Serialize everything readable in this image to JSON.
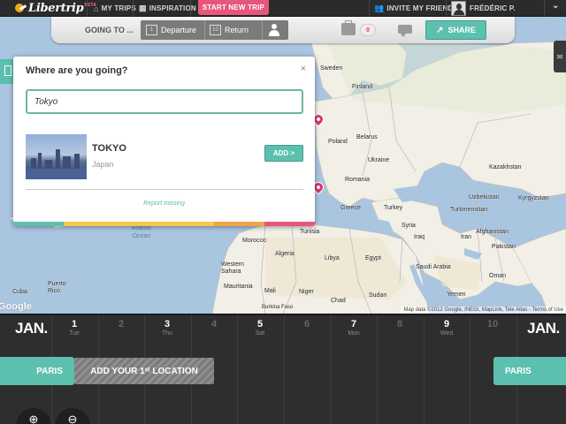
{
  "nav": {
    "logo_text": "Libertrip",
    "beta": "BETA",
    "my_trips": "MY TRIPS",
    "inspiration": "INSPIRATION",
    "start_new_trip": "START NEW TRIP",
    "invite_friends": "INVITE MY FRIENDS",
    "user_name": "FRÉDÉRIC P.",
    "dropdown": "⌄"
  },
  "toolbar": {
    "going_to": "GOING TO ...",
    "departure_label": "Departure",
    "departure_day": "1",
    "return_label": "Return",
    "return_day": "10",
    "luggage_count": "0",
    "share_label": "SHARE"
  },
  "map": {
    "countries": [
      {
        "name": "Sweden"
      },
      {
        "name": "Finland"
      },
      {
        "name": "Poland"
      },
      {
        "name": "Belarus"
      },
      {
        "name": "Ukraine"
      },
      {
        "name": "Romania"
      },
      {
        "name": "Greece"
      },
      {
        "name": "Turkey"
      },
      {
        "name": "Kazakhstan"
      },
      {
        "name": "Uzbekistan"
      },
      {
        "name": "Turkmenistan"
      },
      {
        "name": "Kyrgyzstan"
      },
      {
        "name": "Syria"
      },
      {
        "name": "Iraq"
      },
      {
        "name": "Iran"
      },
      {
        "name": "Afghanistan"
      },
      {
        "name": "Pakistan"
      },
      {
        "name": "Saudi Arabia"
      },
      {
        "name": "Oman"
      },
      {
        "name": "Yemen"
      },
      {
        "name": "Tunisia"
      },
      {
        "name": "Morocco"
      },
      {
        "name": "Algeria"
      },
      {
        "name": "Libya"
      },
      {
        "name": "Egypt"
      },
      {
        "name": "Western Sahara"
      },
      {
        "name": "Mauritania"
      },
      {
        "name": "Mali"
      },
      {
        "name": "Niger"
      },
      {
        "name": "Chad"
      },
      {
        "name": "Sudan"
      },
      {
        "name": "Burkina Faso"
      },
      {
        "name": "Puerto Rico"
      },
      {
        "name": "Cuba"
      }
    ],
    "ocean_label": "Atlantic Ocean",
    "attribution": "Map data ©2012 Google, INEGI, MapLink, Tele Atlas - Terms of Use",
    "google_logo": "Google"
  },
  "popup": {
    "title": "Where are you going?",
    "close": "×",
    "search_value": "Tokyo",
    "result_name": "TOKYO",
    "result_country": "Japan",
    "add_label": "ADD >",
    "report_missing": "Report missing",
    "stripe_colors": [
      "#5dbfae",
      "#f2c94c",
      "#f2c94c",
      "#f2c94c",
      "#f2a34a",
      "#e7577b"
    ]
  },
  "timeline": {
    "month_left": "JAN.",
    "month_right": "JAN.",
    "days": [
      {
        "num": "1",
        "wd": "Tue",
        "dim": false
      },
      {
        "num": "2",
        "wd": "",
        "dim": true
      },
      {
        "num": "3",
        "wd": "Thu",
        "dim": false
      },
      {
        "num": "4",
        "wd": "",
        "dim": true
      },
      {
        "num": "5",
        "wd": "Sat",
        "dim": false
      },
      {
        "num": "6",
        "wd": "",
        "dim": true
      },
      {
        "num": "7",
        "wd": "Mon",
        "dim": false
      },
      {
        "num": "8",
        "wd": "",
        "dim": true
      },
      {
        "num": "9",
        "wd": "Wed",
        "dim": false
      },
      {
        "num": "10",
        "wd": "",
        "dim": true
      }
    ],
    "start_location": "PARIS",
    "add_location": "ADD YOUR 1ˢᵗ LOCATION",
    "end_location": "PARIS"
  },
  "colors": {
    "accent": "#5dbfae",
    "brand_pink": "#e7577b",
    "nav_bg": "#2b2b2b",
    "timeline_bg": "#2e2e2e",
    "ocean": "#a9c5e0",
    "land": "#f2efe6"
  }
}
